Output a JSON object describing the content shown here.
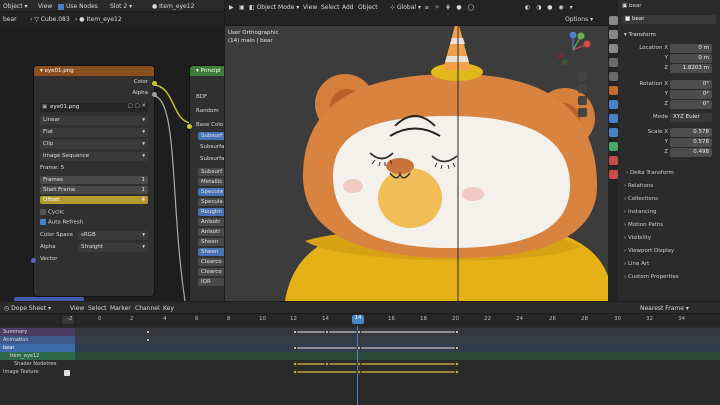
{
  "top_header": {
    "editor_type": "Object",
    "view": "View",
    "use_nodes": "Use Nodes",
    "slot": "Slot 2",
    "material_name": "Item_eye12"
  },
  "breadcrumb": {
    "object": "bear",
    "mesh": "Cube.083",
    "material": "Item_eye12"
  },
  "viewport_header": {
    "mode": "Object Mode",
    "menus": [
      "View",
      "Select",
      "Add",
      "Object"
    ],
    "orientation": "Global",
    "options": "Options"
  },
  "viewport": {
    "view_name": "User Orthographic",
    "collection_info": "(14) main | bear"
  },
  "image_node": {
    "title": "eye01.png",
    "out_color": "Color",
    "out_alpha": "Alpha",
    "image_name": "eye01.png",
    "interpolation": "Linear",
    "projection": "Flat",
    "extension": "Clip",
    "source": "Image Sequence",
    "frame_info": "Frame: 5",
    "frames_label": "Frames",
    "frames_value": "1",
    "start_frame_label": "Start Frame",
    "start_frame_value": "1",
    "offset_label": "Offset",
    "offset_value": "4",
    "cyclic": "Cyclic",
    "auto_refresh": "Auto Refresh",
    "color_space_label": "Color Space",
    "color_space_value": "sRGB",
    "alpha_label": "Alpha",
    "alpha_value": "Straight",
    "vector": "Vector"
  },
  "principled_node": {
    "title": "Principl",
    "rows": [
      "BDF",
      "Random",
      "Base Colo",
      "Subsurf",
      "Subsurfa",
      "Subsurfac",
      "Subsurf",
      "Metallic",
      "Specula",
      "Specula",
      "Roughn",
      "Anisotr",
      "Anisotr",
      "Sheen",
      "Sheen",
      "Clearco",
      "Clearco",
      "IOR"
    ]
  },
  "properties": {
    "object_name": "bear",
    "object_field": "bear",
    "transform": "Transform",
    "location_label": "Location X",
    "location": [
      "0 m",
      "0 m",
      "1.8203 m"
    ],
    "rotation_label": "Rotation X",
    "rotation": [
      "0°",
      "0°",
      "0°"
    ],
    "mode_label": "Mode",
    "mode_value": "XYZ Euler",
    "scale_label": "Scale X",
    "scale": [
      "0.578",
      "0.578",
      "0.498"
    ],
    "y": "Y",
    "z": "Z",
    "sections": [
      "Delta Transform",
      "Relations",
      "Collections",
      "Instancing",
      "Motion Paths",
      "Visibility",
      "Viewport Display",
      "Line Art",
      "Custom Properties"
    ]
  },
  "timeline": {
    "editor": "Dope Sheet",
    "menus": [
      "View",
      "Select",
      "Marker",
      "Channel",
      "Key"
    ],
    "interp": "Nearest Frame",
    "current_frame": "14",
    "frames": [
      "-2",
      "0",
      "2",
      "4",
      "6",
      "8",
      "10",
      "12",
      "14",
      "16",
      "18",
      "20",
      "22",
      "24",
      "26",
      "28",
      "30",
      "32",
      "34"
    ],
    "channels": [
      "Summary",
      "Animation",
      "bear",
      "Item_eye12",
      "Shader Nodetree",
      "Image Texture"
    ]
  },
  "colors": {
    "accent": "#4a82c9",
    "keyframe": "#e8c850",
    "node_image": "#8a4f1e",
    "node_shader": "#3f7f3a",
    "current_frame": "#4a82c9",
    "bear_orange": "#d88440",
    "sweater": "#e8b518"
  }
}
